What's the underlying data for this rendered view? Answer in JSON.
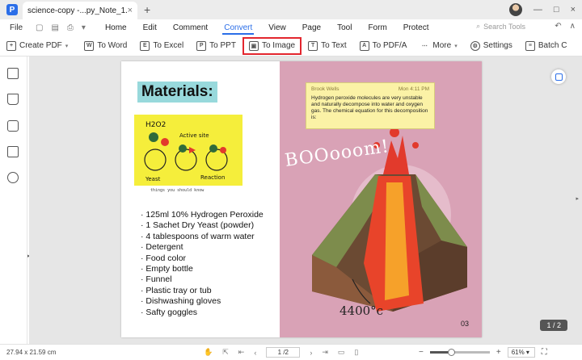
{
  "titlebar": {
    "tab_title": "science-copy -...py_Note_1.pdf",
    "close_glyph": "×",
    "new_tab_glyph": "+",
    "controls": [
      "—",
      "□",
      "×"
    ]
  },
  "menubar": {
    "file": "File",
    "items": [
      "Home",
      "Edit",
      "Comment",
      "Convert",
      "View",
      "Page",
      "Tool",
      "Form",
      "Protect"
    ],
    "active": "Convert",
    "search_placeholder": "Search Tools"
  },
  "toolbar": {
    "items": [
      {
        "label": "Create PDF",
        "icon": "create-pdf-icon",
        "dropdown": true
      },
      {
        "label": "To Word",
        "icon": "word-icon"
      },
      {
        "label": "To Excel",
        "icon": "excel-icon"
      },
      {
        "label": "To PPT",
        "icon": "ppt-icon"
      },
      {
        "label": "To Image",
        "icon": "image-icon",
        "highlighted": true
      },
      {
        "label": "To Text",
        "icon": "text-icon"
      },
      {
        "label": "To PDF/A",
        "icon": "pdfa-icon"
      },
      {
        "label": "More",
        "icon": "more-icon",
        "dropdown": true
      },
      {
        "label": "Settings",
        "icon": "settings-icon"
      },
      {
        "label": "Batch C",
        "icon": "batch-icon"
      }
    ]
  },
  "document": {
    "heading": "Materials:",
    "yellow_box": {
      "label_h2o2": "H2O2",
      "label_active": "Active site",
      "label_yeast": "Yeast",
      "label_reaction": "Reaction"
    },
    "small_note": "things you should know",
    "materials": [
      "125ml 10% Hydrogen Peroxide",
      "1 Sachet Dry Yeast (powder)",
      "4 tablespoons of warm water",
      "Detergent",
      "Food color",
      "Empty bottle",
      "Funnel",
      "Plastic tray or tub",
      "Dishwashing gloves",
      "Safty goggles"
    ],
    "note": {
      "author": "Brook Wells",
      "time": "Mon 4:11 PM",
      "text": "Hydrogen peroxide molecules are very unstable and naturally decompose into water and oxygen gas. The chemical equation for this decomposition is:"
    },
    "boom_text": "BOOooom!",
    "temperature": "4400°c",
    "page_label": "03"
  },
  "page_counter": "1 / 2",
  "statusbar": {
    "dimensions": "27.94 x 21.59 cm",
    "page_input": "1 /2",
    "zoom": "61%",
    "zoom_level": 0.35
  },
  "colors": {
    "accent": "#2b6ee8",
    "highlight_border": "#e3262e",
    "page_pink": "#d9a2b6",
    "heading_bg": "#98d9dc",
    "yellow_box": "#f5ee3b"
  }
}
